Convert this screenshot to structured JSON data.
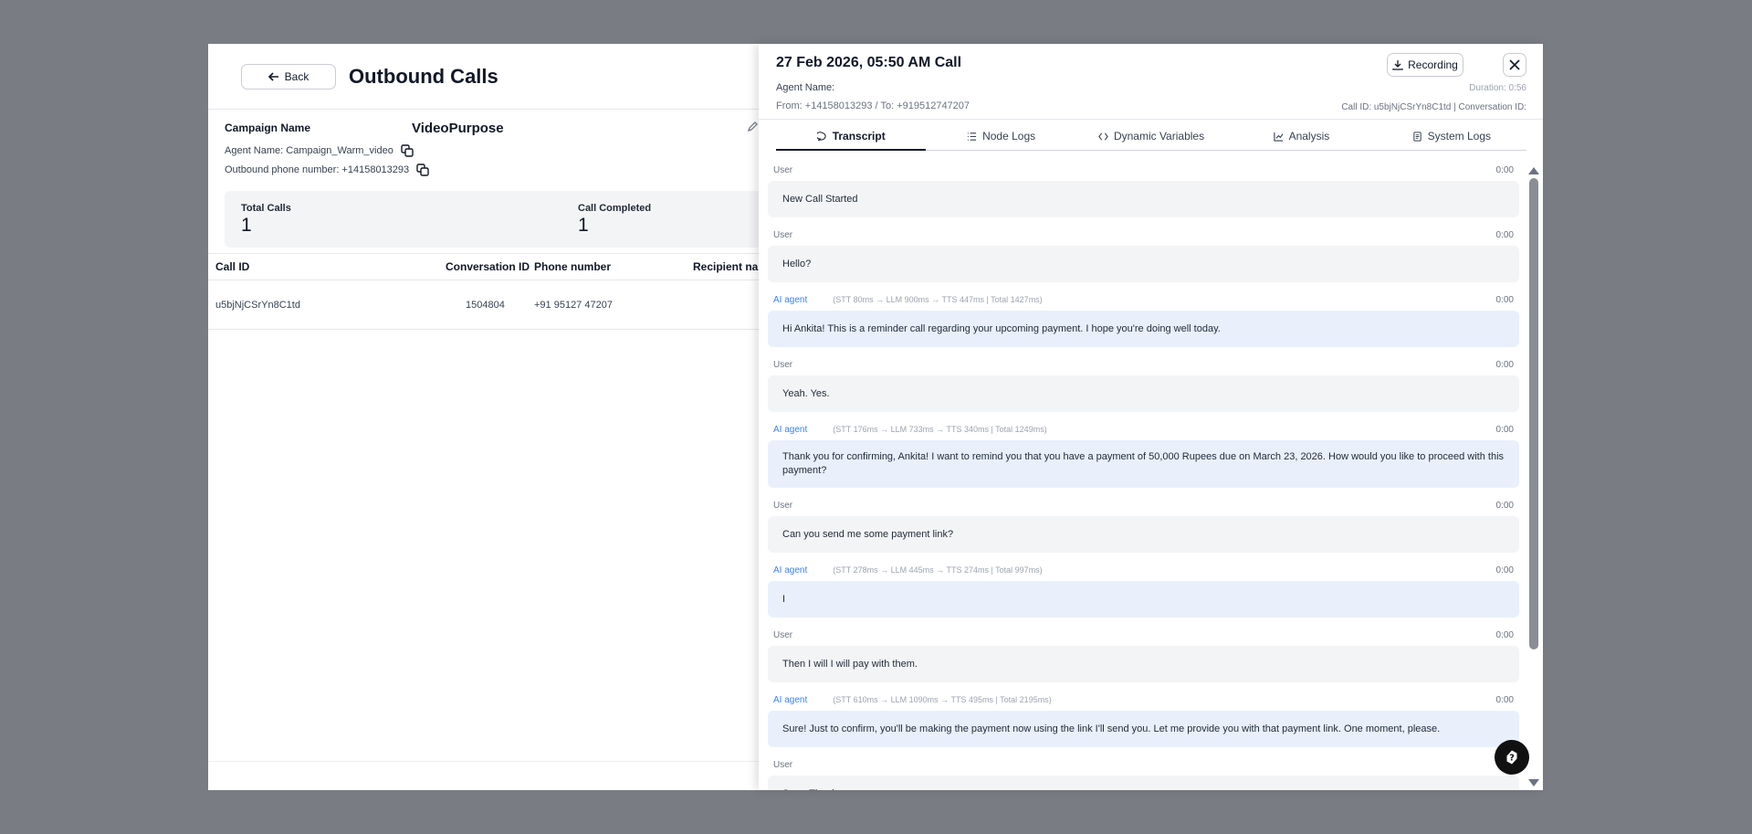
{
  "page": {
    "back_label": "Back",
    "title": "Outbound Calls"
  },
  "campaign": {
    "name_label": "Campaign Name",
    "name_value": "VideoPurpose",
    "agent_name": "Agent Name: Campaign_Warm_video",
    "outbound_number": "Outbound phone number: +14158013293"
  },
  "stats": [
    {
      "label": "Total Calls",
      "value": "1"
    },
    {
      "label": "Call Completed",
      "value": "1"
    }
  ],
  "table": {
    "columns": [
      "Call ID",
      "Conversation ID",
      "Phone number",
      "Recipient nam"
    ],
    "rows": [
      {
        "call_id": "u5bjNjCSrYn8C1td",
        "conversation_id": "1504804",
        "phone": "+91 95127 47207"
      }
    ]
  },
  "panel": {
    "title": "27 Feb 2026, 05:50 AM Call",
    "agent_name": "Agent Name:",
    "from_to": "From: +14158013293 / To: +919512747207",
    "recording_label": "Recording",
    "duration": "Duration: 0:56",
    "call_ids": "Call ID: u5bjNjCSrYn8C1td | Conversation ID:",
    "tabs": [
      "Transcript",
      "Node Logs",
      "Dynamic Variables",
      "Analysis",
      "System Logs"
    ],
    "messages": [
      {
        "speaker": "User",
        "role": "user",
        "latency": "",
        "time": "0:00",
        "text": "New Call Started"
      },
      {
        "speaker": "User",
        "role": "user",
        "latency": "",
        "time": "0:00",
        "text": "Hello?"
      },
      {
        "speaker": "AI agent",
        "role": "ai",
        "latency": "(STT 80ms → LLM 900ms → TTS 447ms | Total 1427ms)",
        "time": "0:00",
        "text": "Hi Ankita! This is a reminder call regarding your upcoming payment. I hope you're doing well today."
      },
      {
        "speaker": "User",
        "role": "user",
        "latency": "",
        "time": "0:00",
        "text": "Yeah. Yes."
      },
      {
        "speaker": "AI agent",
        "role": "ai",
        "latency": "(STT 176ms → LLM 733ms → TTS 340ms | Total 1249ms)",
        "time": "0:00",
        "text": "Thank you for confirming, Ankita! I want to remind you that you have a payment of 50,000 Rupees due on March 23, 2026. How would you like to proceed with this payment?"
      },
      {
        "speaker": "User",
        "role": "user",
        "latency": "",
        "time": "0:00",
        "text": "Can you send me some payment link?"
      },
      {
        "speaker": "AI agent",
        "role": "ai",
        "latency": "(STT 278ms → LLM 445ms → TTS 274ms | Total 997ms)",
        "time": "0:00",
        "text": "I"
      },
      {
        "speaker": "User",
        "role": "user",
        "latency": "",
        "time": "0:00",
        "text": "Then I will I will pay with them."
      },
      {
        "speaker": "AI agent",
        "role": "ai",
        "latency": "(STT 610ms → LLM 1090ms → TTS 495ms | Total 2195ms)",
        "time": "0:00",
        "text": "Sure! Just to confirm, you'll be making the payment now using the link I'll send you. Let me provide you with that payment link. One moment, please."
      },
      {
        "speaker": "User",
        "role": "user",
        "latency": "",
        "time": "",
        "text": "Sure. Thank you."
      }
    ]
  },
  "icons": {
    "back": "arrow-left-icon",
    "edit": "pencil-icon",
    "copy": "copy-icon",
    "recording": "download-icon",
    "close": "close-icon",
    "help": "help-icon"
  },
  "colors": {
    "overlay": "#7a7c84",
    "ai_bubble": "#e9f0fc",
    "user_bubble": "#f3f4f6",
    "ai_speaker": "#3b82f6"
  }
}
